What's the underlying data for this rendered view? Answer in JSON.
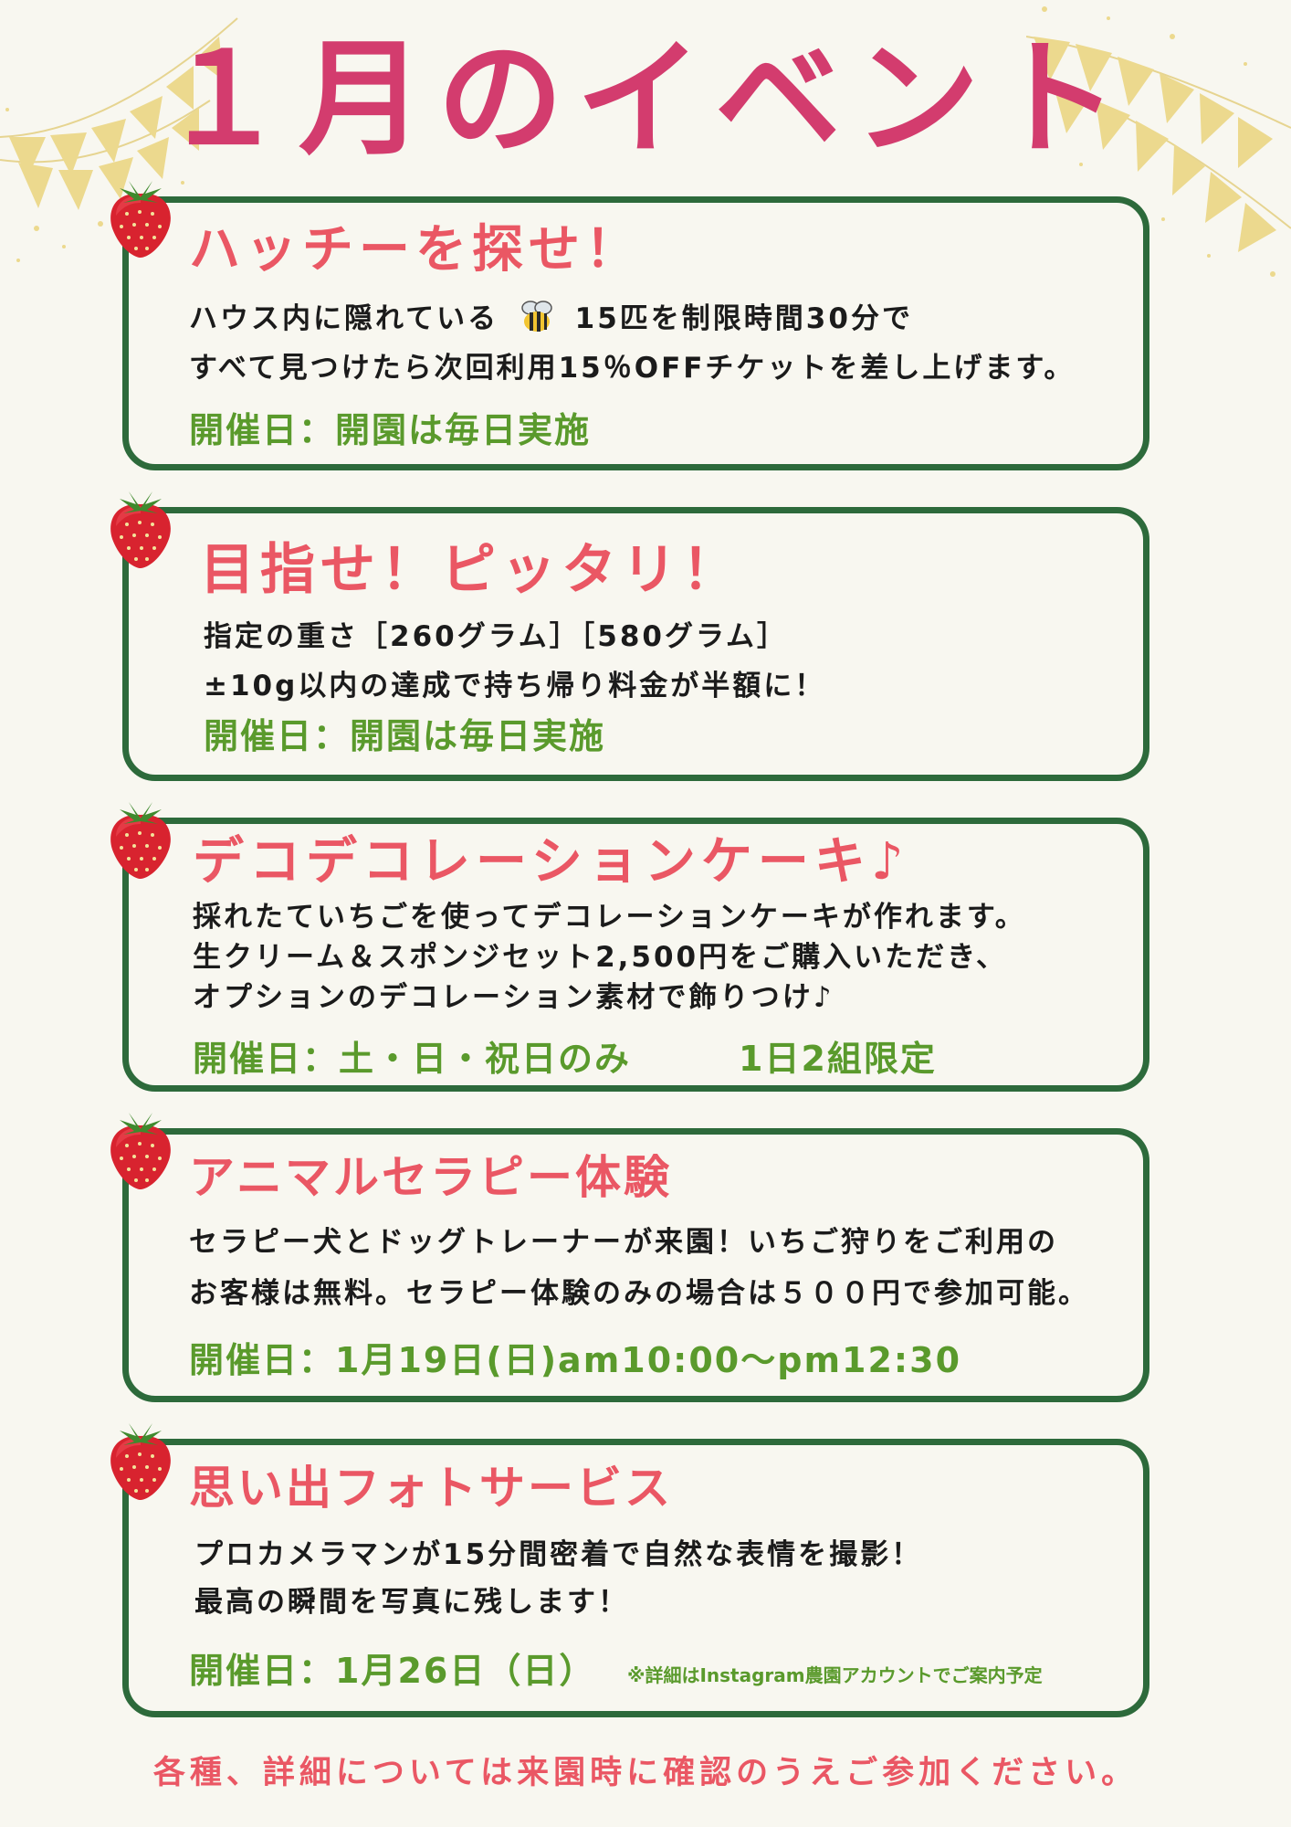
{
  "title": "１月のイベント",
  "events": [
    {
      "title": "ハッチーを探せ！",
      "body_line1_before": "ハウス内に隠れている",
      "body_line1_icon": "bee-icon",
      "body_line1_after": "15匹を制限時間30分で",
      "body_line2": "すべて見つけたら次回利用15％OFFチケットを差し上げます。",
      "date": "開催日：開園は毎日実施"
    },
    {
      "title": "目指せ！ピッタリ！",
      "body_line1": "指定の重さ［260グラム］［580グラム］",
      "body_line2": "±10g以内の達成で持ち帰り料金が半額に！",
      "date": "開催日：開園は毎日実施"
    },
    {
      "title": "デコデコレーションケーキ♪",
      "body_line1": "採れたていちごを使ってデコレーションケーキが作れます。",
      "body_line2": "生クリーム＆スポンジセット2,500円をご購入いただき、",
      "body_line3": "オプションのデコレーション素材で飾りつけ♪",
      "date": "開催日：土・日・祝日のみ",
      "date_extra": "1日2組限定"
    },
    {
      "title": "アニマルセラピー体験",
      "body_line1": "セラピー犬とドッグトレーナーが来園！いちご狩りをご利用の",
      "body_line2": "お客様は無料。セラピー体験のみの場合は５００円で参加可能。",
      "date": "開催日：1月19日(日)am10:00～pm12:30"
    },
    {
      "title": "思い出フォトサービス",
      "body_line1": "プロカメラマンが15分間密着で自然な表情を撮影！",
      "body_line2": "最高の瞬間を写真に残します！",
      "date": "開催日：1月26日（日）",
      "note": "※詳細はInstagram農園アカウントでご案内予定"
    }
  ],
  "footer": "各種、詳細については来園時に確認のうえご参加ください。",
  "colors": {
    "title": "#d33c6e",
    "card_title": "#ea5764",
    "border": "#2d6a3b",
    "date": "#5a9a2c",
    "background": "#f8f7f0",
    "bunting": "#ecd98e",
    "strawberry": "#d8232f"
  },
  "icons": [
    "strawberry-icon",
    "bee-icon",
    "bunting-decoration"
  ]
}
